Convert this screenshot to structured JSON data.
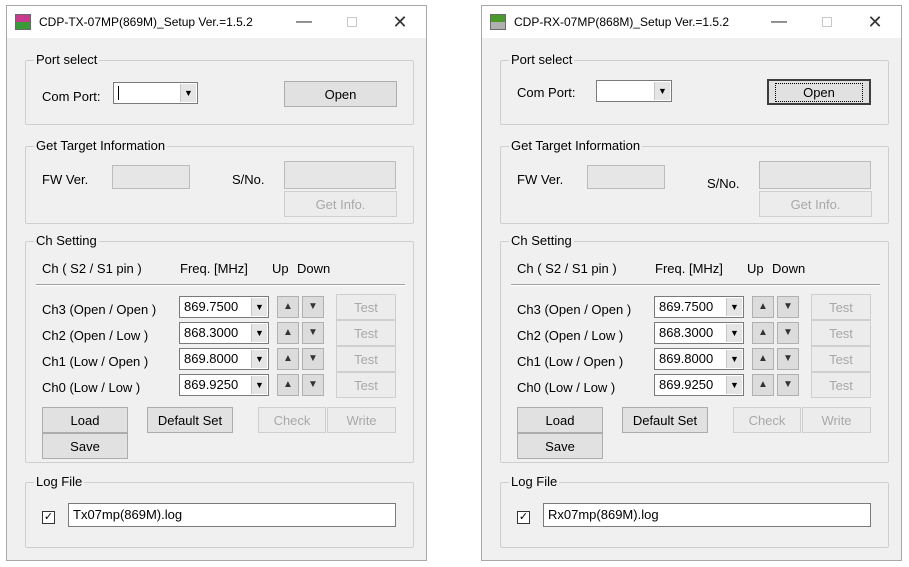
{
  "windows": [
    {
      "title": "CDP-TX-07MP(869M)_Setup   Ver.=1.5.2",
      "icon_text": "TX",
      "port": {
        "group_title": "Port select",
        "com_port_label": "Com Port:",
        "com_port_value": "",
        "open_label": "Open"
      },
      "target": {
        "group_title": "Get Target Information",
        "fw_label": "FW Ver.",
        "fw_value": "",
        "sno_label": "S/No.",
        "sno_value": "",
        "get_info_label": "Get Info."
      },
      "ch": {
        "group_title": "Ch Setting",
        "header": {
          "ch": "Ch    ( S2 / S1 pin )",
          "freq": "Freq. [MHz]",
          "up": "Up",
          "down": "Down"
        },
        "rows": [
          {
            "label": "Ch3  (Open / Open )",
            "freq": "869.7500",
            "test": "Test"
          },
          {
            "label": "Ch2  (Open / Low    )",
            "freq": "868.3000",
            "test": "Test"
          },
          {
            "label": "Ch1  (Low    / Open )",
            "freq": "869.8000",
            "test": "Test"
          },
          {
            "label": "Ch0  (Low   /  Low    )",
            "freq": "869.9250",
            "test": "Test"
          }
        ],
        "load_label": "Load",
        "default_label": "Default Set",
        "check_label": "Check",
        "write_label": "Write",
        "save_label": "Save"
      },
      "log": {
        "group_title": "Log File",
        "checked": true,
        "filename": "Tx07mp(869M).log"
      }
    },
    {
      "title": "CDP-RX-07MP(868M)_Setup   Ver.=1.5.2",
      "icon_text": "RX",
      "port": {
        "group_title": "Port select",
        "com_port_label": "Com Port:",
        "com_port_value": "",
        "open_label": "Open"
      },
      "target": {
        "group_title": "Get Target Information",
        "fw_label": "FW Ver.",
        "fw_value": "",
        "sno_label": "S/No.",
        "sno_value": "",
        "get_info_label": "Get Info."
      },
      "ch": {
        "group_title": "Ch Setting",
        "header": {
          "ch": "Ch    ( S2 / S1 pin )",
          "freq": "Freq. [MHz]",
          "up": "Up",
          "down": "Down"
        },
        "rows": [
          {
            "label": "Ch3  (Open / Open )",
            "freq": "869.7500",
            "test": "Test"
          },
          {
            "label": "Ch2  (Open / Low    )",
            "freq": "868.3000",
            "test": "Test"
          },
          {
            "label": "Ch1  (Low    / Open )",
            "freq": "869.8000",
            "test": "Test"
          },
          {
            "label": "Ch0  (Low   /  Low    )",
            "freq": "869.9250",
            "test": "Test"
          }
        ],
        "load_label": "Load",
        "default_label": "Default Set",
        "check_label": "Check",
        "write_label": "Write",
        "save_label": "Save"
      },
      "log": {
        "group_title": "Log File",
        "checked": true,
        "filename": "Rx07mp(869M).log"
      }
    }
  ],
  "glyphs": {
    "minimize": "—",
    "close": "✕",
    "dropdown": "▼",
    "up": "▲",
    "down": "▼",
    "check": "✓"
  }
}
